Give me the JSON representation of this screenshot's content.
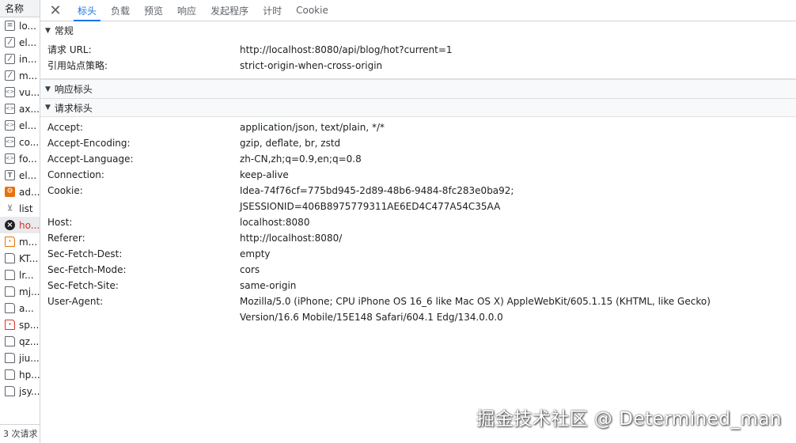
{
  "file_panel": {
    "header": "名称",
    "items": [
      {
        "name": "lo...",
        "icon": "doc-icon",
        "cls": "doc"
      },
      {
        "name": "el...",
        "icon": "image-icon",
        "cls": "img"
      },
      {
        "name": "in...",
        "icon": "image-icon",
        "cls": "img"
      },
      {
        "name": "m...",
        "icon": "image-icon",
        "cls": "img"
      },
      {
        "name": "vu...",
        "icon": "script-icon",
        "cls": "code"
      },
      {
        "name": "ax...",
        "icon": "script-icon",
        "cls": "code"
      },
      {
        "name": "el...",
        "icon": "script-icon",
        "cls": "code"
      },
      {
        "name": "co...",
        "icon": "script-icon",
        "cls": "code"
      },
      {
        "name": "fo...",
        "icon": "script-icon",
        "cls": "code"
      },
      {
        "name": "el...",
        "icon": "font-icon",
        "cls": "font"
      },
      {
        "name": "ad...",
        "icon": "xhr-icon",
        "cls": "xhr"
      },
      {
        "name": "list",
        "icon": "fetch-icon",
        "cls": "list"
      },
      {
        "name": "ho...",
        "icon": "error-icon",
        "cls": "err",
        "selected": true
      },
      {
        "name": "m...",
        "icon": "orange-file-icon",
        "cls": "orange"
      },
      {
        "name": "KT...",
        "icon": "file-icon",
        "cls": "page"
      },
      {
        "name": "lr...",
        "icon": "file-icon",
        "cls": "page"
      },
      {
        "name": "mj...",
        "icon": "file-icon",
        "cls": "page"
      },
      {
        "name": "a...",
        "icon": "file-icon",
        "cls": "page"
      },
      {
        "name": "sp...",
        "icon": "red-file-icon",
        "cls": "red"
      },
      {
        "name": "qz...",
        "icon": "file-icon",
        "cls": "page"
      },
      {
        "name": "jiu...",
        "icon": "file-icon",
        "cls": "page"
      },
      {
        "name": "hp...",
        "icon": "file-icon",
        "cls": "page"
      },
      {
        "name": "jsy...",
        "icon": "file-icon",
        "cls": "page"
      }
    ],
    "footer": "3 次请求"
  },
  "tabs": {
    "close_icon": "close-icon",
    "items": [
      {
        "label": "标头",
        "active": true
      },
      {
        "label": "负载"
      },
      {
        "label": "预览"
      },
      {
        "label": "响应"
      },
      {
        "label": "发起程序"
      },
      {
        "label": "计时"
      },
      {
        "label": "Cookie"
      }
    ]
  },
  "general": {
    "title": "常规",
    "rows": [
      {
        "key": "请求 URL:",
        "value": "http://localhost:8080/api/blog/hot?current=1"
      },
      {
        "key": "引用站点策略:",
        "value": "strict-origin-when-cross-origin"
      }
    ]
  },
  "response_headers": {
    "title": "响应标头"
  },
  "request_headers": {
    "title": "请求标头",
    "rows": [
      {
        "key": "Accept:",
        "value": "application/json, text/plain, */*"
      },
      {
        "key": "Accept-Encoding:",
        "value": "gzip, deflate, br, zstd"
      },
      {
        "key": "Accept-Language:",
        "value": "zh-CN,zh;q=0.9,en;q=0.8"
      },
      {
        "key": "Connection:",
        "value": "keep-alive"
      },
      {
        "key": "Cookie:",
        "value": "Idea-74f76cf=775bd945-2d89-48b6-9484-8fc283e0ba92; JSESSIONID=406B8975779311AE6ED4C477A54C35AA"
      },
      {
        "key": "Host:",
        "value": "localhost:8080"
      },
      {
        "key": "Referer:",
        "value": "http://localhost:8080/"
      },
      {
        "key": "Sec-Fetch-Dest:",
        "value": "empty"
      },
      {
        "key": "Sec-Fetch-Mode:",
        "value": "cors"
      },
      {
        "key": "Sec-Fetch-Site:",
        "value": "same-origin"
      },
      {
        "key": "User-Agent:",
        "value": "Mozilla/5.0 (iPhone; CPU iPhone OS 16_6 like Mac OS X) AppleWebKit/605.1.15 (KHTML, like Gecko) Version/16.6 Mobile/15E148 Safari/604.1 Edg/134.0.0.0"
      }
    ]
  },
  "watermark": "掘金技术社区 @ Determined_man",
  "colors": {
    "accent": "#1a73e8",
    "error": "#d93025"
  }
}
